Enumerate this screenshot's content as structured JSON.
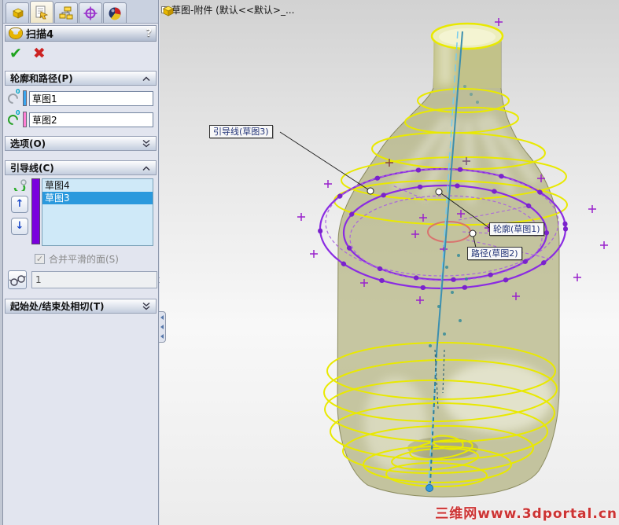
{
  "panel": {
    "title": "扫描4",
    "help_label": "?",
    "tabs": [
      "part-tree-tab",
      "property-manager-tab",
      "configuration-tab",
      "dimxpert-tab",
      "display-manager-tab"
    ],
    "sections": {
      "profile_path": {
        "label": "轮廓和路径(P)",
        "profile_value": "草图1",
        "path_value": "草图2"
      },
      "options": {
        "label": "选项(O)"
      },
      "guide_curves": {
        "label": "引导线(C)",
        "items": [
          "草图4",
          "草图3"
        ],
        "selected_item": "草图3",
        "merge_label": "合并平滑的面(S)",
        "spinner_value": "1"
      },
      "start_end_tangency": {
        "label": "起始处/结束处相切(T)"
      }
    }
  },
  "viewport": {
    "tree_item": "草图-附件 (默认<<默认>_...",
    "expand_glyph": "+",
    "callouts": {
      "guide": "引导线(草图3)",
      "profile": "轮廓(草图1)",
      "path": "路径(草图2)"
    },
    "watermark": "三维网www.3dportal.cn",
    "colors": {
      "edge_yellow": "#e9e900",
      "guide_purple": "#8a2be2",
      "path_blue": "#3d8fae",
      "bottle_olive": "#a8a86e",
      "selection_blue": "#2b99dd",
      "profile_swatch": "#3aa6f0",
      "path_swatch": "#ff7fd4",
      "guide_swatch": "#7a00dd",
      "watermark_red": "#cc3333",
      "highlight_red": "#dd6666"
    }
  }
}
